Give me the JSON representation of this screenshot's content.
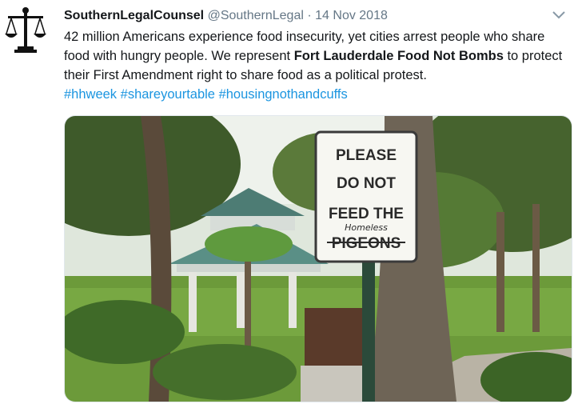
{
  "tweet": {
    "display_name": "SouthernLegalCounsel",
    "handle": "@SouthernLegal",
    "separator": "·",
    "date": "14 Nov 2018",
    "text_part1": "42 million Americans experience food insecurity, yet cities arrest people who share food with hungry people. We represent ",
    "text_bold": "Fort Lauderdale Food Not Bombs",
    "text_part2": " to protect their First Amendment right to share food as a political protest.",
    "hashtags": [
      "#hhweek",
      "#shareyourtable",
      "#housingnothandcuffs"
    ]
  },
  "photo": {
    "sign_line1": "PLEASE",
    "sign_line2": "DO NOT",
    "sign_line3": "FEED THE",
    "sign_handwritten": "Homeless",
    "sign_line4": "PIGEONS"
  },
  "icons": {
    "avatar": "scales-of-justice-icon",
    "menu": "chevron-down-icon"
  },
  "colors": {
    "link": "#1b95e0",
    "muted": "#657786",
    "text": "#14171a"
  }
}
